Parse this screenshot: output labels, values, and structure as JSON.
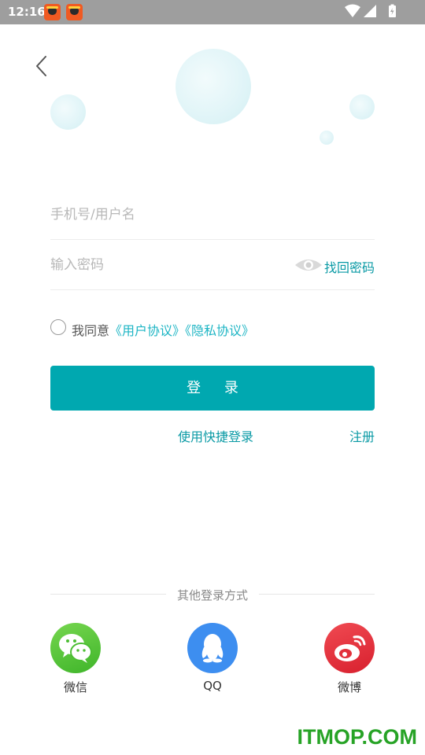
{
  "status_bar": {
    "time": "12:16"
  },
  "login": {
    "username_placeholder": "手机号/用户名",
    "password_placeholder": "输入密码",
    "forgot_password": "找回密码",
    "agree_prefix": "我同意",
    "user_agreement": "《用户协议》",
    "privacy_agreement": "《隐私协议》",
    "login_button": "登 录",
    "quick_login": "使用快捷登录",
    "register": "注册"
  },
  "other_login": {
    "title": "其他登录方式",
    "options": [
      {
        "label": "微信",
        "icon": "wechat-icon",
        "color": "#5ac83a"
      },
      {
        "label": "QQ",
        "icon": "qq-icon",
        "color": "#3d8ef0"
      },
      {
        "label": "微博",
        "icon": "weibo-icon",
        "color": "#e8303c"
      }
    ]
  },
  "watermark": "ITMOP.COM",
  "colors": {
    "accent": "#00a8b0",
    "link": "#0a9aa5",
    "status_bar": "#9e9e9e"
  }
}
